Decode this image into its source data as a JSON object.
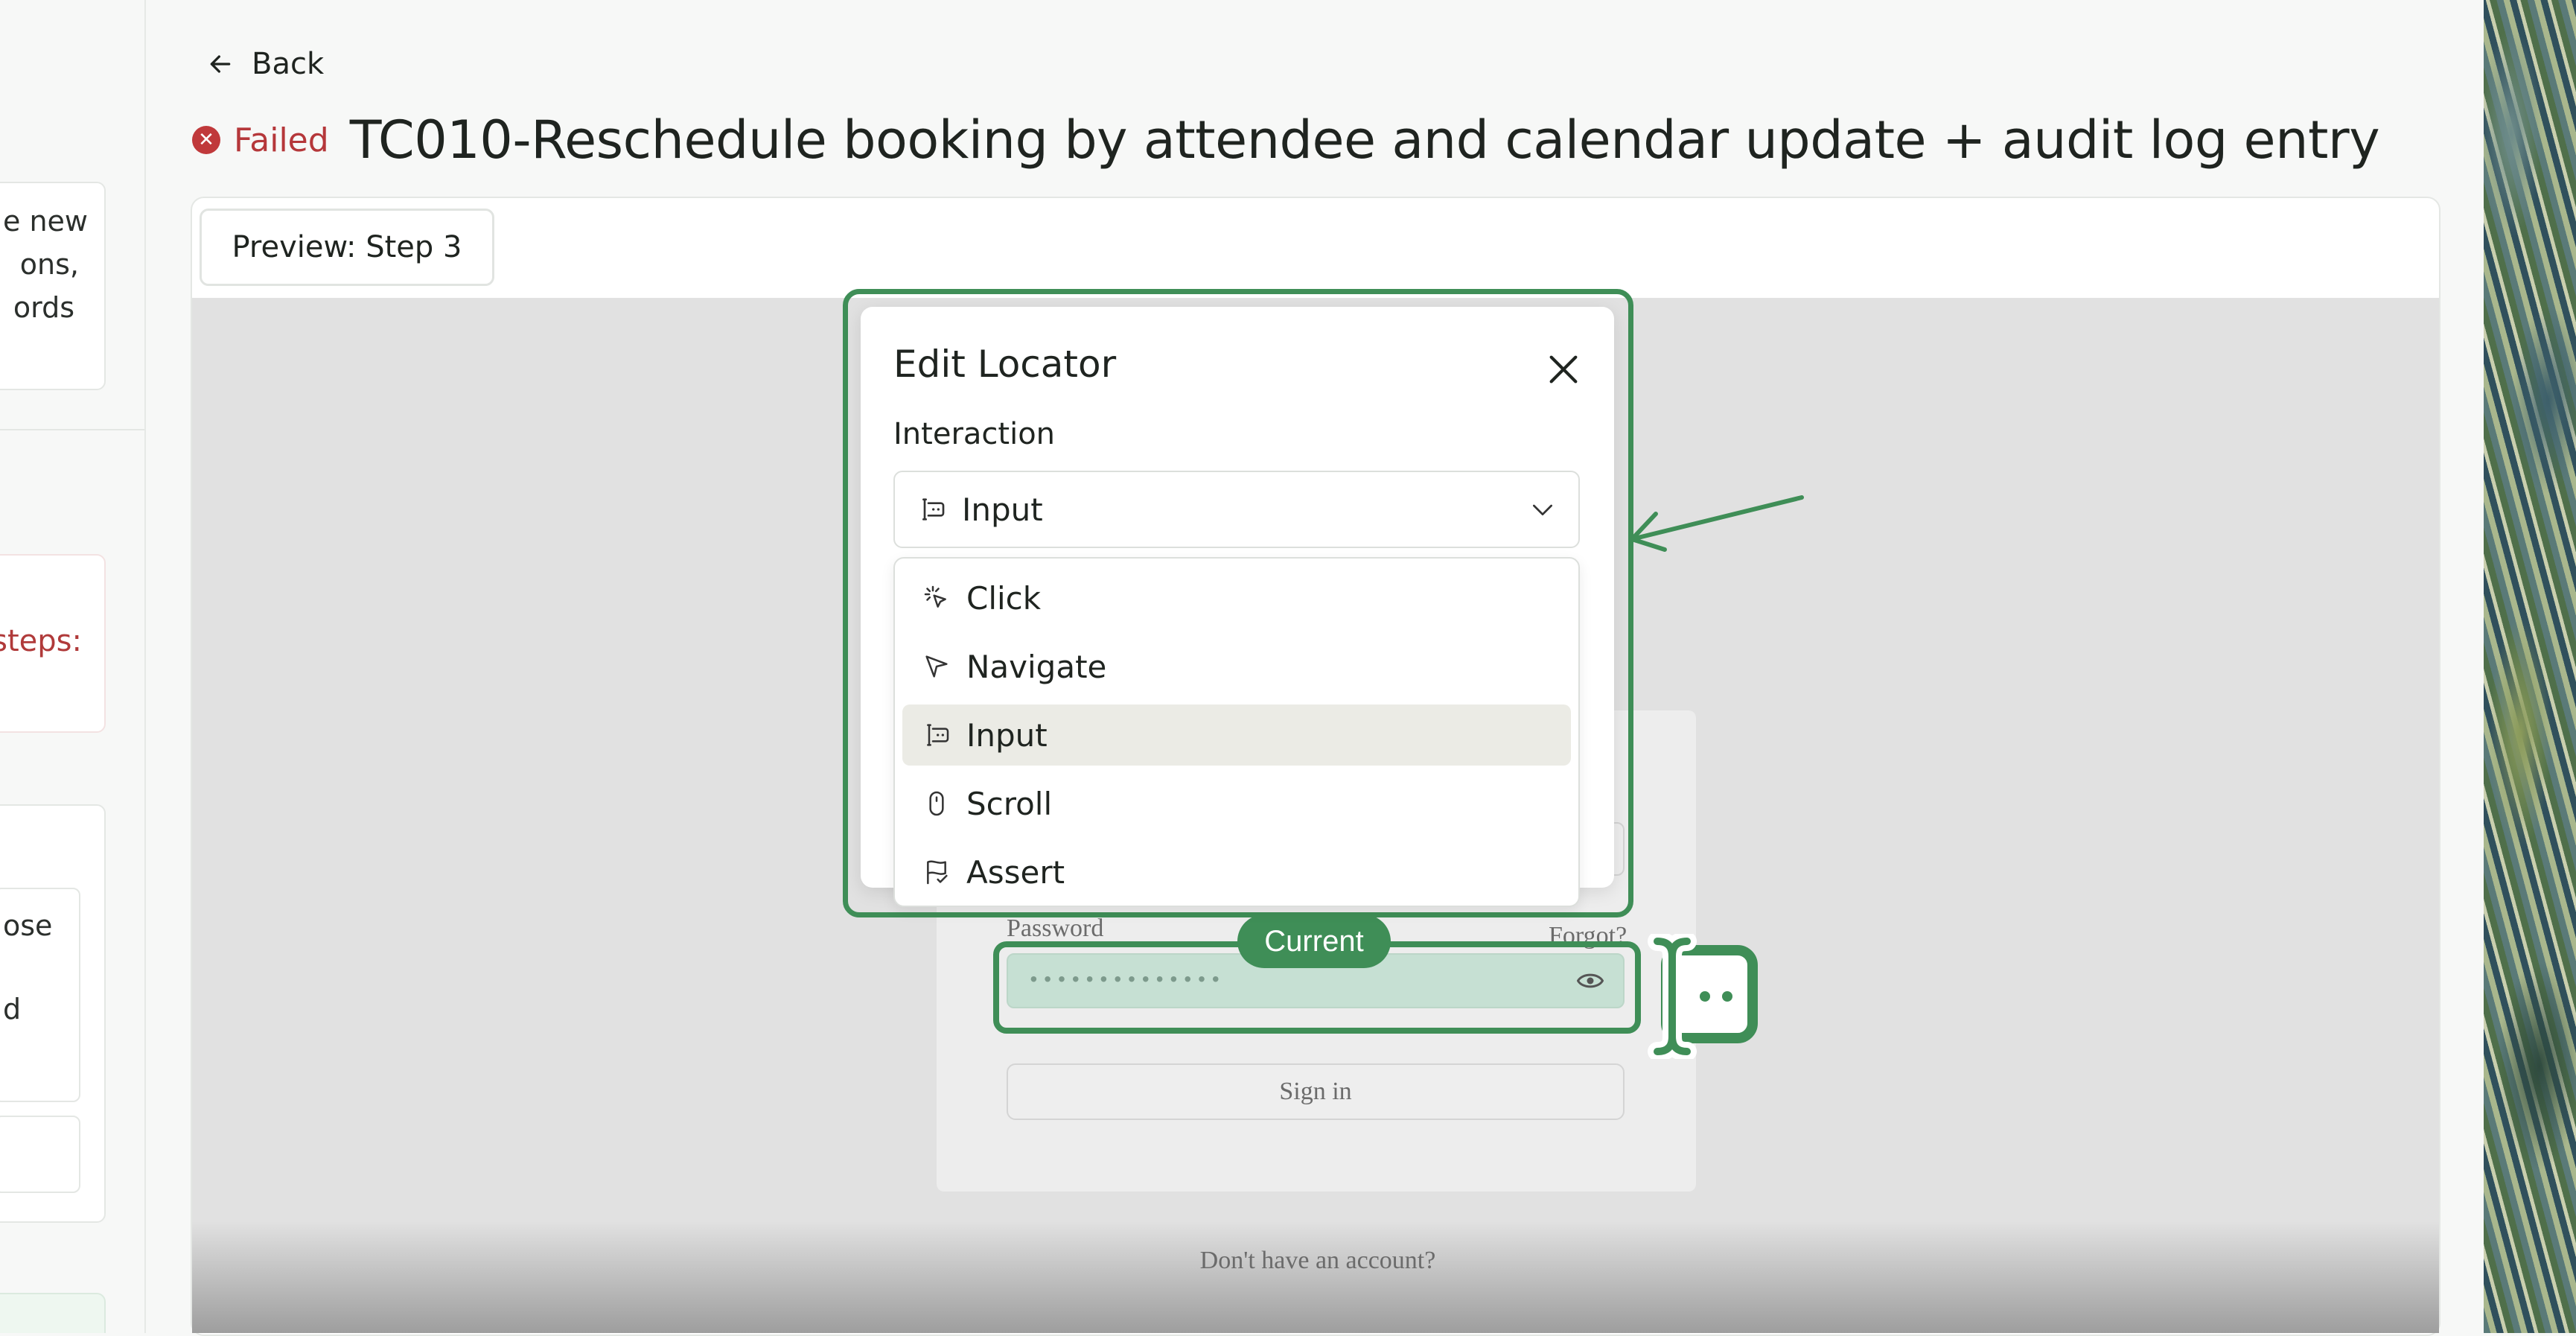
{
  "sidebar": {
    "card1_lines": [
      "e new",
      "ons,",
      "ords"
    ],
    "steps_label": "steps:",
    "card3_lines": [
      "ose",
      "d"
    ]
  },
  "header": {
    "back_label": "Back",
    "status": "Failed",
    "title": "TC010-Reschedule booking by attendee and calendar update + audit log entry"
  },
  "preview": {
    "tab_label": "Preview: Step 3"
  },
  "signin_form": {
    "password_label": "Password",
    "forgot_label": "Forgot?",
    "password_value": "••••••••••••••",
    "signin_label": "Sign in",
    "no_account": "Don't have an account?"
  },
  "highlight": {
    "current_badge": "Current",
    "accent_color": "#3f8e57"
  },
  "edit_locator": {
    "title": "Edit Locator",
    "interaction_label": "Interaction",
    "selected_value": "Input",
    "selected_icon": "text-cursor-input-icon",
    "options": [
      {
        "label": "Click",
        "icon": "mouse-pointer-click-icon",
        "active": false
      },
      {
        "label": "Navigate",
        "icon": "navigation-pointer-icon",
        "active": false
      },
      {
        "label": "Input",
        "icon": "text-cursor-input-icon",
        "active": true
      },
      {
        "label": "Scroll",
        "icon": "mouse-scroll-icon",
        "active": false
      },
      {
        "label": "Assert",
        "icon": "flag-check-icon",
        "active": false
      }
    ]
  },
  "colors": {
    "failed": "#b5373a",
    "accent": "#3f8e57",
    "menu_active_bg": "#ebebe5"
  }
}
